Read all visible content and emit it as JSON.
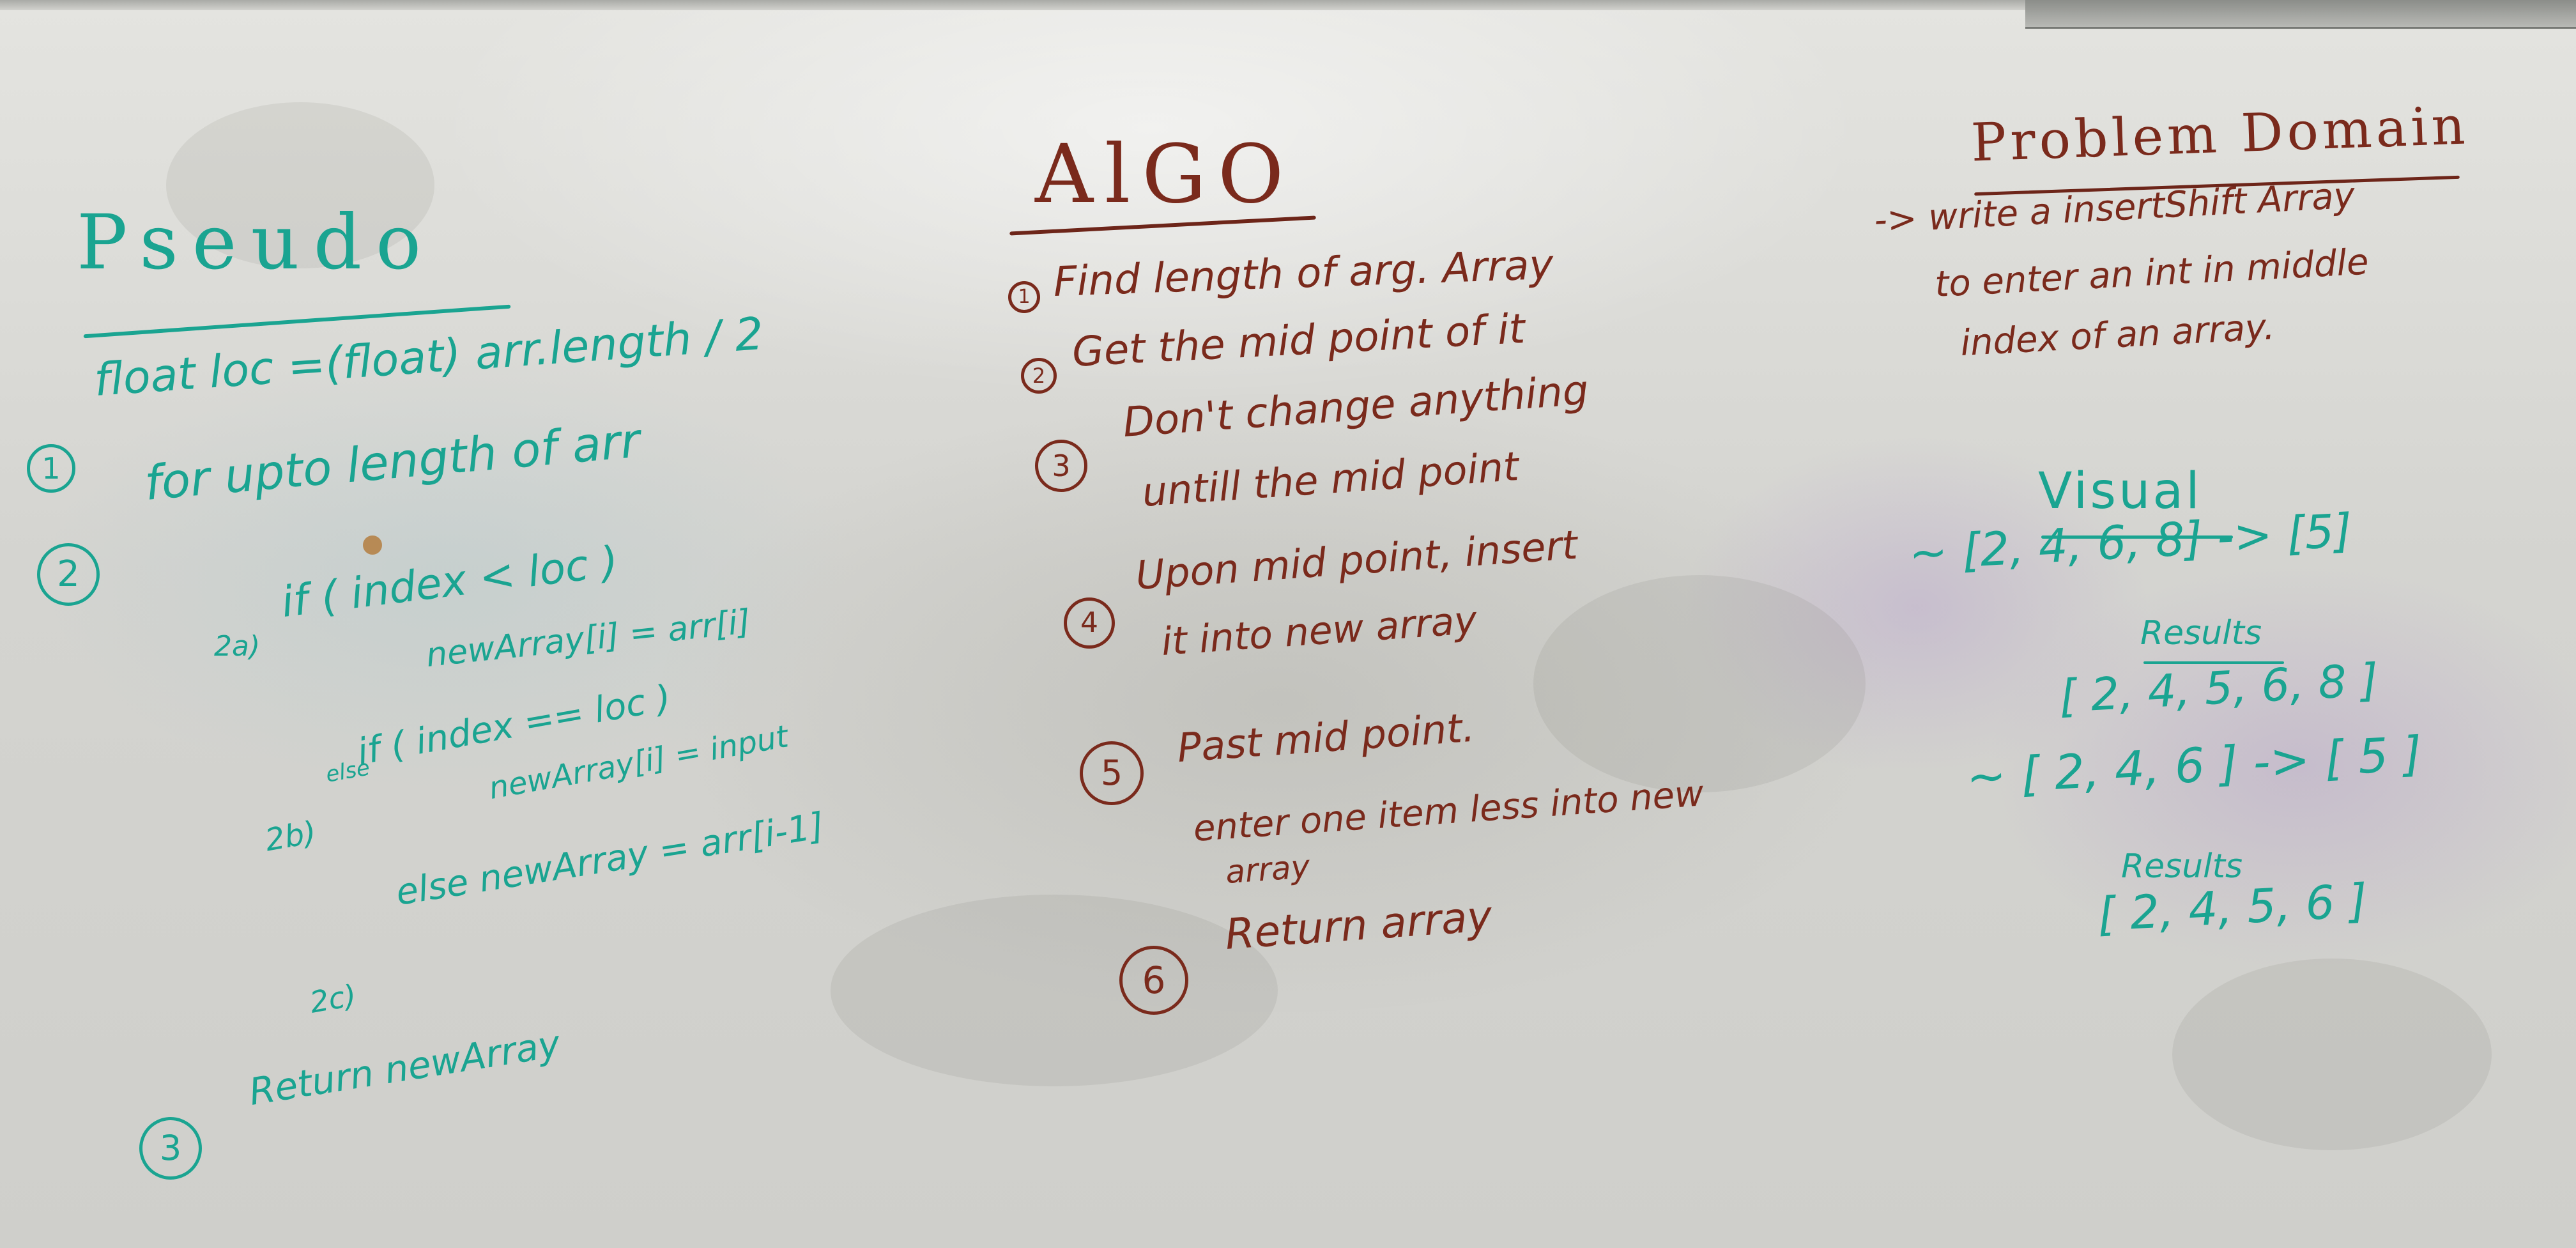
{
  "pseudo": {
    "title": "Pseudo",
    "line1_num": "1",
    "line1": "float loc =(float) arr.length / 2",
    "line2_num": "2",
    "line2": "for upto length of arr",
    "line2a_label": "2a)",
    "line2a": "if ( index < loc )",
    "line2a_body": "newArray[i] = arr[i]",
    "line2b_label": "2b)",
    "line2b_else": "else",
    "line2b": "if ( index == loc )",
    "line2b_body": "newArray[i] = input",
    "line2c_label": "2c)",
    "line2c": "else  newArray = arr[i-1]",
    "line3_num": "3",
    "line3": "Return newArray"
  },
  "algo": {
    "title": "AlGO",
    "step1_num": "1",
    "step1": "Find length of arg. Array",
    "step2_num": "2",
    "step2": "Get the mid point of it",
    "step3_num": "3",
    "step3a": "Don't change anything",
    "step3b": "untill the mid point",
    "step4_num": "4",
    "step4a": "Upon mid point, insert",
    "step4b": "it into new array",
    "step5_num": "5",
    "step5a": "Past mid point.",
    "step5b": "enter one item less into new",
    "step5c": "array",
    "step6_num": "6",
    "step6": "Return array"
  },
  "problem": {
    "title": "Problem Domain",
    "line1": "-> write a insertShift Array",
    "line2": "to enter an int in middle",
    "line3": "index of an array.",
    "visual_title": "Visual",
    "ex1_input": "~ [2, 4, 6, 8] -> [5]",
    "ex1_results_label": "Results",
    "ex1_output": "[ 2, 4, 5, 6, 8 ]",
    "ex2_input": "~ [ 2, 4, 6 ] -> [ 5 ]",
    "ex2_results_label": "Results",
    "ex2_output": "[ 2, 4, 5, 6 ]"
  },
  "colors": {
    "teal_marker": "#1aa491",
    "maroon_marker": "#7a2a1c",
    "board": "#d9d9d5"
  }
}
